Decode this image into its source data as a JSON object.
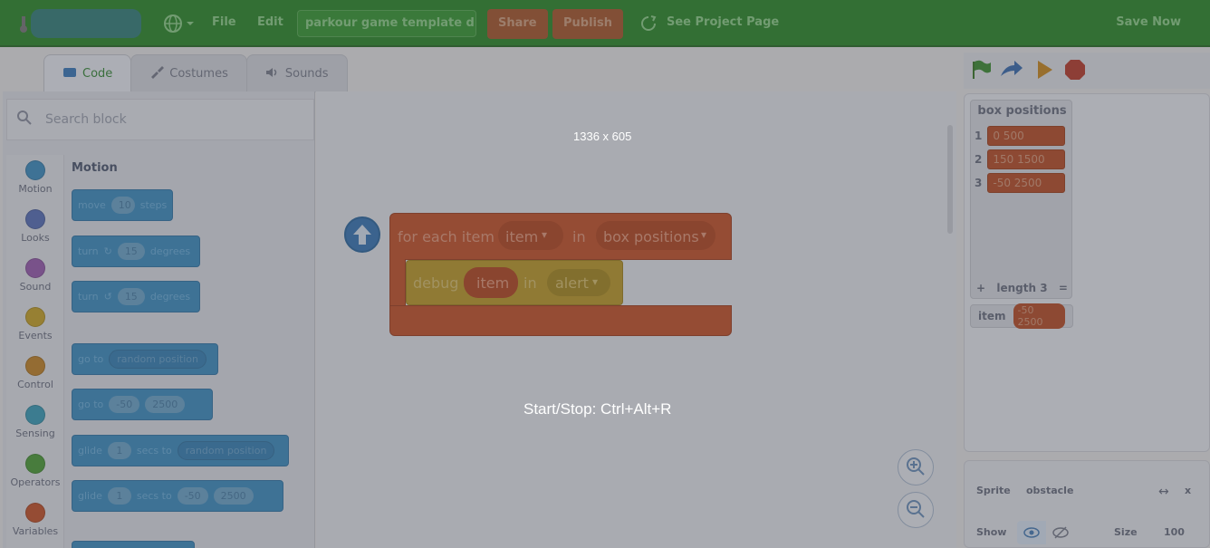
{
  "menu": {
    "file": "File",
    "edit": "Edit",
    "project_title": "parkour game template d...",
    "share": "Share",
    "publish": "Publish",
    "see_project_page": "See Project Page",
    "save_now": "Save Now"
  },
  "tabs": [
    {
      "label": "Code"
    },
    {
      "label": "Costumes"
    },
    {
      "label": "Sounds"
    }
  ],
  "palette": {
    "search_placeholder": "Search block",
    "section_title": "Motion",
    "categories": [
      {
        "label": "Motion",
        "color": "#3f8fc0"
      },
      {
        "label": "Looks",
        "color": "#5a72b8"
      },
      {
        "label": "Sound",
        "color": "#9a5fb0"
      },
      {
        "label": "Events",
        "color": "#c8a52a"
      },
      {
        "label": "Control",
        "color": "#c4862a"
      },
      {
        "label": "Sensing",
        "color": "#3d9fb8"
      },
      {
        "label": "Operators",
        "color": "#4f9f3a"
      },
      {
        "label": "Variables",
        "color": "#c5552b"
      }
    ],
    "blocks": {
      "move": {
        "pre": "move",
        "val": "10",
        "post": "steps"
      },
      "turn_right": {
        "pre": "turn",
        "val": "15",
        "post": "degrees"
      },
      "turn_left": {
        "pre": "turn",
        "val": "15",
        "post": "degrees"
      },
      "goto": {
        "pre": "go to",
        "drop": "random position"
      },
      "goto_xy": {
        "pre": "go to",
        "x": "-50",
        "y": "2500"
      },
      "glide_random": {
        "pre": "glide",
        "val": "1",
        "mid": "secs to",
        "drop": "random position"
      },
      "glide_xy": {
        "pre": "glide",
        "val": "1",
        "mid": "secs to",
        "x": "-50",
        "y": "2500"
      }
    }
  },
  "workspace": {
    "for_each_label": "for each item",
    "item_var": "item",
    "in_label": "in",
    "list_name": "box positions",
    "debug_label": "debug",
    "debug_item": "item",
    "debug_in": "in",
    "debug_target": "alert",
    "size_overlay": "1336 x 605",
    "hotkey_overlay": "Start/Stop: Ctrl+Alt+R"
  },
  "stage": {
    "list_monitor": {
      "title": "box positions",
      "items": [
        {
          "index": "1",
          "value": "0 500"
        },
        {
          "index": "2",
          "value": "150 1500"
        },
        {
          "index": "3",
          "value": "-50 2500"
        }
      ],
      "plus": "+",
      "length_label": "length 3",
      "equals": "="
    },
    "var_monitor": {
      "label": "item",
      "value": "-50 2500"
    }
  },
  "sprite_info": {
    "sprite_label": "Sprite",
    "sprite_name": "obstacle",
    "x_label": "x",
    "show_label": "Show",
    "size_label": "Size",
    "size_value": "100"
  }
}
